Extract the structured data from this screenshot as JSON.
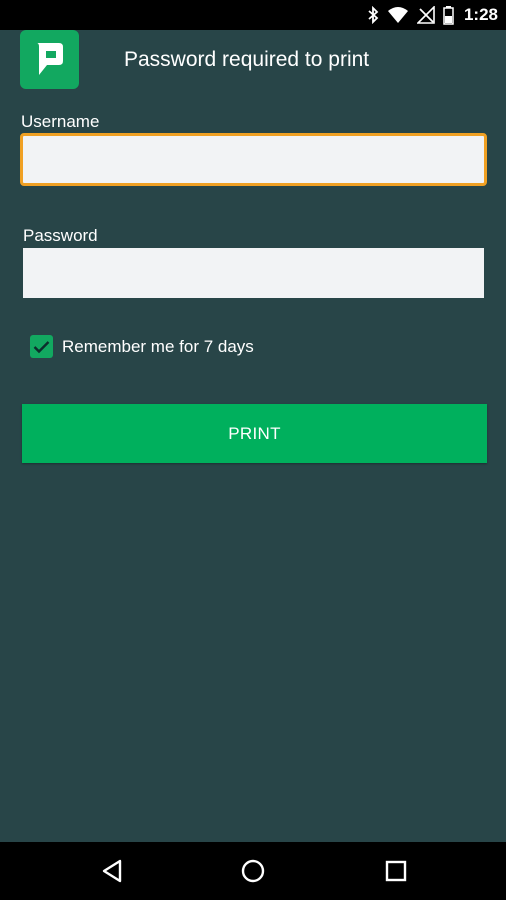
{
  "status_bar": {
    "time": "1:28",
    "icons": [
      "bluetooth-icon",
      "wifi-icon",
      "no-signal-icon",
      "battery-icon"
    ]
  },
  "header": {
    "logo_icon": "papercut-logo-icon",
    "title": "Password required to print"
  },
  "form": {
    "username_label": "Username",
    "username_value": "",
    "password_label": "Password",
    "password_value": "",
    "remember_label": "Remember me for 7 days",
    "remember_checked": true,
    "print_label": "PRINT"
  },
  "nav_bar": {
    "icons": [
      "back-icon",
      "home-icon",
      "recent-apps-icon"
    ]
  },
  "colors": {
    "background": "#284548",
    "accent": "#00b05d",
    "focus_border": "#f0a023"
  }
}
